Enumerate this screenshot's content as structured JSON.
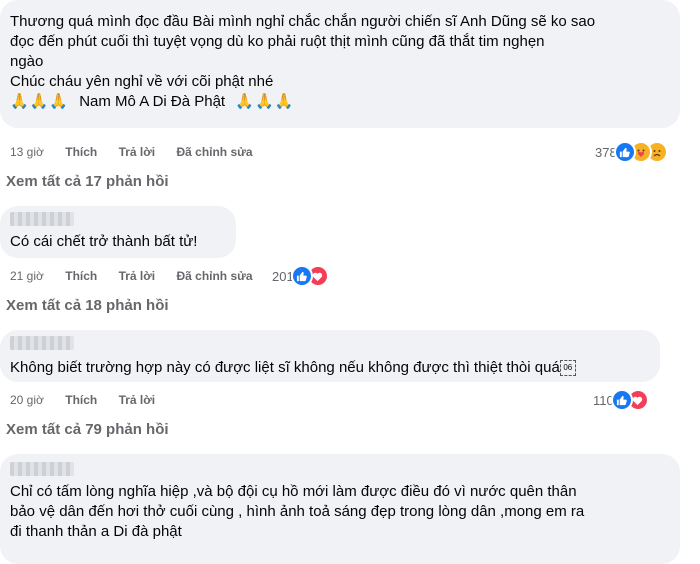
{
  "comments": [
    {
      "lines": [
        "Thương quá mình đọc đầu Bài mình nghỉ chắc chắn người chiến sĩ Anh Dũng sẽ ko sao",
        "đọc đến phút cuối thì tuyệt vọng dù ko phải ruột thịt mình cũng đã thắt tim nghẹn",
        "ngào",
        "Chúc cháu yên nghỉ về với cõi phật nhé"
      ],
      "prayer_left": "🙏🙏🙏",
      "prayer_text": "Nam Mô A Di Đà Phật",
      "prayer_right": "🙏🙏🙏",
      "time": "13 giờ",
      "like": "Thích",
      "reply": "Trả lời",
      "edited": "Đã chỉnh sửa",
      "reaction_count": "378",
      "reactions": [
        "like-icon",
        "care-icon",
        "sad-icon"
      ],
      "view_replies": "Xem tất cả 17 phản hồi"
    },
    {
      "lines": [
        "Có cái chết trở thành bất tử!"
      ],
      "time": "21 giờ",
      "like": "Thích",
      "reply": "Trả lời",
      "edited": "Đã chỉnh sửa",
      "reaction_count": "201",
      "reactions": [
        "like-icon",
        "heart-icon"
      ],
      "view_replies": "Xem tất cả 18 phản hồi"
    },
    {
      "lines": [
        "Không biết trường hợp này có được liệt sĩ không nếu không được thì thiệt thòi quá"
      ],
      "emote_code": "06",
      "time": "20 giờ",
      "like": "Thích",
      "reply": "Trả lời",
      "reaction_count": "110",
      "reactions": [
        "like-icon",
        "heart-icon"
      ],
      "view_replies": "Xem tất cả 79 phản hồi"
    },
    {
      "lines": [
        "Chỉ có tấm lòng nghĩa hiệp ,và bộ đội cụ hồ mới làm được điều đó vì nước quên thân",
        "bảo vệ dân đến hơi thở cuối cùng , hình ảnh toả sáng đẹp trong lòng dân ,mong em ra",
        "đi thanh thản a Di đà phật"
      ]
    }
  ],
  "colors": {
    "like": "#1877f2",
    "heart": "#f33e58",
    "care": "#f7b125",
    "bubble": "#f0f2f5",
    "meta": "#65676b"
  }
}
